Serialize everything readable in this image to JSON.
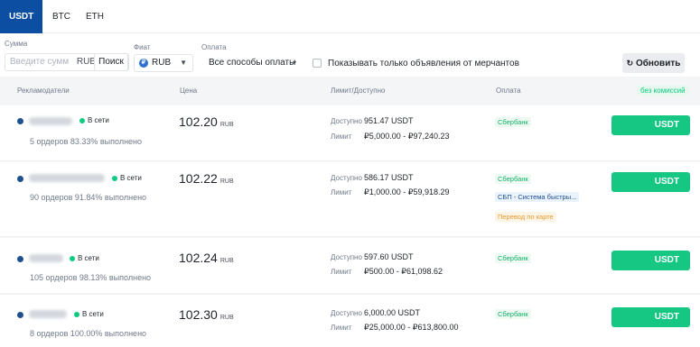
{
  "tabs": [
    {
      "label": "USDT",
      "active": true
    },
    {
      "label": "BTC",
      "active": false
    },
    {
      "label": "ETH",
      "active": false
    }
  ],
  "filters": {
    "amount_label": "Сумма",
    "amount_placeholder": "Введите сумм",
    "amount_currency": "RUB",
    "search_label": "Поиск",
    "fiat_label": "Фиат",
    "fiat_value": "RUB",
    "fiat_icon_glyph": "₽",
    "payment_label": "Оплата",
    "payment_value": "Все способы оплаты",
    "merchants_only_label": "Показывать только объявления от мерчантов",
    "merchants_only_checked": false,
    "refresh_label": "Обновить"
  },
  "table": {
    "headers": {
      "advertiser": "Рекламодатели",
      "price": "Цена",
      "limit": "Лимит/Доступно",
      "payment": "Оплата",
      "no_fee": "без комиссий"
    },
    "available_label": "Доступно",
    "limit_label": "Лимит",
    "online_label": "В сети",
    "buy_label": "USDT",
    "rows": [
      {
        "orders": "5 ордеров",
        "completion": "83.33% выполнено",
        "price": "102.20",
        "currency": "RUB",
        "available": "951.47 USDT",
        "limit": "₽5,000.00 - ₽97,240.23",
        "payments": [
          "Сбербанк"
        ]
      },
      {
        "orders": "90 ордеров",
        "completion": "91.84% выполнено",
        "price": "102.22",
        "currency": "RUB",
        "available": "586.17 USDT",
        "limit": "₽1,000.00 - ₽59,918.29",
        "payments": [
          "Сбербанк",
          "СБП - Система быстры...",
          "Перевод по карте"
        ]
      },
      {
        "orders": "105 ордеров",
        "completion": "98.13% выполнено",
        "price": "102.24",
        "currency": "RUB",
        "available": "597.60 USDT",
        "limit": "₽500.00 - ₽61,098.62",
        "payments": [
          "Сбербанк"
        ]
      },
      {
        "orders": "8 ордеров",
        "completion": "100.00% выполнено",
        "price": "102.30",
        "currency": "RUB",
        "available": "6,000.00 USDT",
        "limit": "₽25,000.00 - ₽613,800.00",
        "payments": [
          "Сбербанк"
        ]
      }
    ]
  },
  "colors": {
    "accent": "#0b4ea2",
    "buy": "#16c784",
    "online": "#0ecb81"
  }
}
